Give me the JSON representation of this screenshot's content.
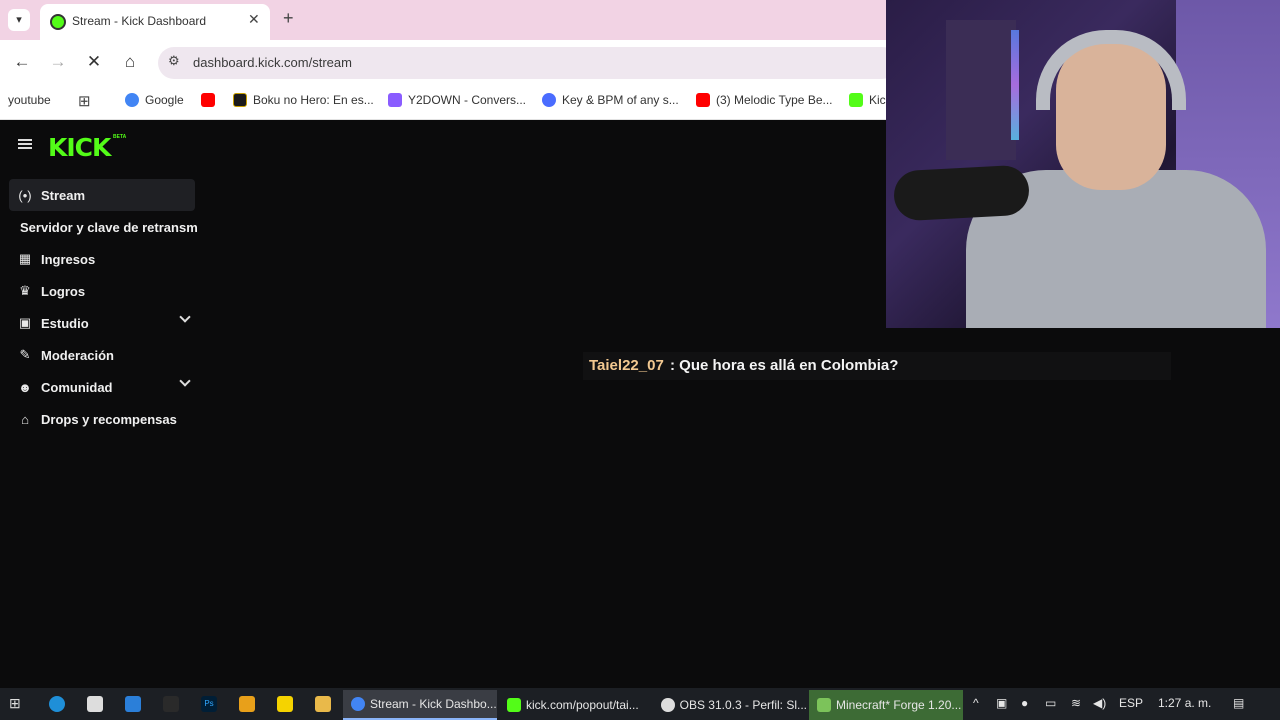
{
  "browser": {
    "tab_title": "Stream - Kick Dashboard",
    "url": "dashboard.kick.com/stream",
    "bookmarks": [
      {
        "label": "youtube",
        "icon": "youtube-icon",
        "color": "#ff0000"
      },
      {
        "label": "Google",
        "icon": "google-icon",
        "color": "#4285f4"
      },
      {
        "label": "Boku no Hero: En es...",
        "icon": "boku-icon",
        "color": "#1b1b1b"
      },
      {
        "label": "Y2DOWN - Convers...",
        "icon": "y2down-icon",
        "color": "#8a5cff"
      },
      {
        "label": "Key & BPM of any s...",
        "icon": "key-bpm-icon",
        "color": "#4a6cff"
      },
      {
        "label": "(3) Melodic Type Be...",
        "icon": "youtube-icon",
        "color": "#ff0000"
      },
      {
        "label": "Kic",
        "icon": "kick-icon",
        "color": "#53fc18"
      }
    ]
  },
  "kick": {
    "logo": "KICK",
    "beta": "BETA",
    "accent": "#53fc18",
    "nav": [
      {
        "label": "Stream",
        "icon": "stream-icon",
        "glyph": "(•)"
      },
      {
        "label": "Servidor y clave de retransm",
        "icon": "",
        "glyph": ""
      },
      {
        "label": "Ingresos",
        "icon": "chart-icon",
        "glyph": "▦"
      },
      {
        "label": "Logros",
        "icon": "trophy-icon",
        "glyph": "🏆"
      },
      {
        "label": "Estudio",
        "icon": "studio-icon",
        "glyph": "▣"
      },
      {
        "label": "Moderación",
        "icon": "wrench-icon",
        "glyph": "🔧"
      },
      {
        "label": "Comunidad",
        "icon": "community-icon",
        "glyph": "👥"
      },
      {
        "label": "Drops y recompensas",
        "icon": "gift-icon",
        "glyph": "🎁"
      }
    ]
  },
  "chat": {
    "username": "Taiel22_07",
    "message": ": Que hora es allá en Colombia?",
    "username_color": "#f2c890"
  },
  "taskbar": {
    "apps": [
      {
        "label": "Stream - Kick Dashbo...",
        "icon": "chrome-icon"
      },
      {
        "label": "kick.com/popout/tai...",
        "icon": "kick-icon"
      },
      {
        "label": "OBS 31.0.3 - Perfil: Sl...",
        "icon": "obs-icon"
      },
      {
        "label": "Minecraft* Forge 1.20...",
        "icon": "minecraft-icon"
      }
    ],
    "language": "ESP",
    "time": "1:27 a. m."
  }
}
